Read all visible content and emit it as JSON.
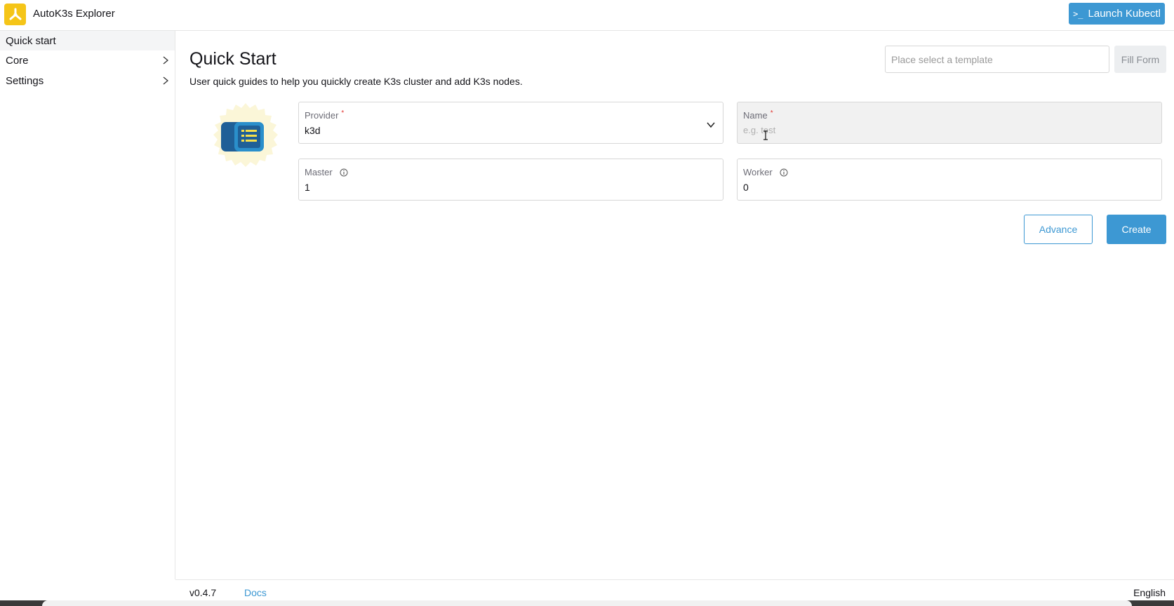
{
  "app": {
    "title": "AutoK3s Explorer",
    "logo_icon": "autok3s-logo-icon",
    "launch_label": "Launch Kubectl",
    "launch_icon": "terminal-icon",
    "launch_icon_glyph": ">_"
  },
  "sidebar": {
    "items": [
      {
        "label": "Quick start",
        "active": true
      },
      {
        "label": "Core",
        "expandable": true
      },
      {
        "label": "Settings",
        "expandable": true
      }
    ]
  },
  "main": {
    "title": "Quick Start",
    "description": "User quick guides to help you quickly create K3s cluster and add K3s nodes.",
    "template_placeholder": "Place select a template",
    "fill_form_label": "Fill Form",
    "form": {
      "provider": {
        "label": "Provider",
        "required_mark": "*",
        "value": "k3d"
      },
      "name": {
        "label": "Name",
        "required_mark": "*",
        "placeholder": "e.g. test",
        "value": ""
      },
      "master": {
        "label": "Master",
        "value": "1"
      },
      "worker": {
        "label": "Worker",
        "value": "0"
      }
    },
    "advance_label": "Advance",
    "create_label": "Create"
  },
  "footer": {
    "version": "v0.4.7",
    "docs_label": "Docs",
    "language": "English"
  },
  "colors": {
    "accent": "#3d98d3",
    "logo": "#f5c518",
    "required": "#e3342f"
  }
}
